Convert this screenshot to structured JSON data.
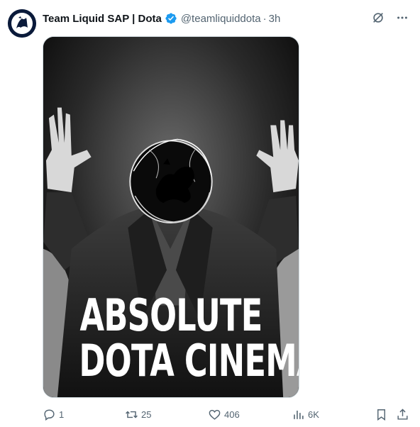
{
  "tweet": {
    "author_name": "Team Liquid SAP | Dota",
    "handle": "@teamliquiddota",
    "separator": "·",
    "time_ago": "3h",
    "media": {
      "caption_line1": "ABSOLUTE",
      "caption_line2": "DOTA CINEMA"
    },
    "actions": {
      "replies": "1",
      "reposts": "25",
      "likes": "406",
      "views": "6K"
    }
  },
  "icons": {
    "verified": "verified-badge-icon",
    "grok": "grok-icon",
    "more": "more-icon",
    "reply": "reply-icon",
    "repost": "repost-icon",
    "like": "like-icon",
    "views": "views-icon",
    "bookmark": "bookmark-icon",
    "share": "share-icon"
  },
  "colors": {
    "verified": "#1d9bf0",
    "text_secondary": "#536471",
    "avatar_bg": "#0a1a3a"
  }
}
